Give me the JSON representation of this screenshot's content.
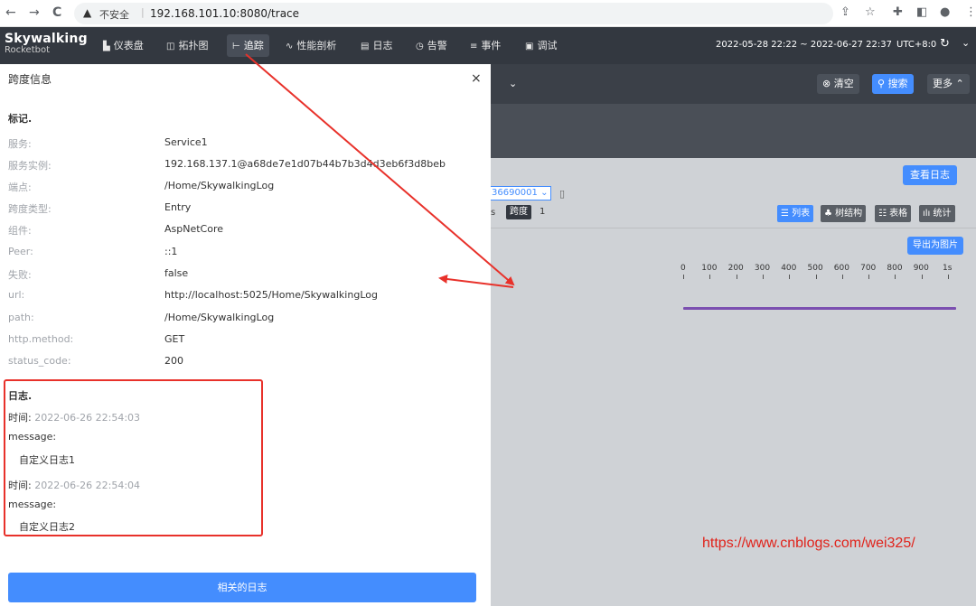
{
  "browser": {
    "back_glyph": "←",
    "forward_glyph": "→",
    "reload_glyph": "C",
    "warn_glyph": "▲",
    "insecure_label": "不安全",
    "separator": "|",
    "url": "192.168.101.10:8080/trace",
    "icons": [
      "share-icon",
      "star-icon",
      "extension-icon",
      "sidebar-icon",
      "profile-icon",
      "menu-icon"
    ]
  },
  "app": {
    "logo_title": "Skywalking",
    "logo_subtitle": "Rocketbot",
    "nav": [
      {
        "label": "仪表盘",
        "icon": "dashboard-icon",
        "glyph": "▙"
      },
      {
        "label": "拓扑图",
        "icon": "topology-icon",
        "glyph": "◫"
      },
      {
        "label": "追踪",
        "icon": "trace-icon",
        "glyph": "⊢",
        "active": true
      },
      {
        "label": "性能剖析",
        "icon": "profile-icon",
        "glyph": "∿"
      },
      {
        "label": "日志",
        "icon": "log-icon",
        "glyph": "▤"
      },
      {
        "label": "告警",
        "icon": "alarm-icon",
        "glyph": "◷"
      },
      {
        "label": "事件",
        "icon": "event-icon",
        "glyph": "≡"
      },
      {
        "label": "调试",
        "icon": "debug-icon",
        "glyph": "▣"
      }
    ],
    "date_range": "2022-05-28 22:22 ~ 2022-06-27 22:37",
    "timezone": "UTC+8:0",
    "refresh_glyph": "↻",
    "chevron_glyph": "⌃"
  },
  "toolbar": {
    "dropdown_glyph": "⌄",
    "clear_label": "清空",
    "search_label": "搜索",
    "more_label": "更多"
  },
  "trace": {
    "view_logs_label": "查看日志",
    "trace_id_partial": "36690001",
    "select_glyph": "⌄",
    "duration_suffix": "s",
    "span_label": "跨度",
    "span_count": "1",
    "views": [
      "列表",
      "树结构",
      "表格",
      "统计"
    ],
    "view_glyphs": [
      "☰",
      "♣",
      "☷",
      "ılı"
    ],
    "export_label": "导出为图片",
    "axis_ticks": [
      "0",
      "100",
      "200",
      "300",
      "400",
      "500",
      "600",
      "700",
      "800",
      "900",
      "1s"
    ]
  },
  "drawer": {
    "title": "跨度信息",
    "close_glyph": "×",
    "tags_title": "标记.",
    "fields": [
      {
        "key": "服务:",
        "value": "Service1"
      },
      {
        "key": "服务实例:",
        "value": "192.168.137.1@a68de7e1d07b44b7b3d4d3eb6f3d8beb"
      },
      {
        "key": "端点:",
        "value": "/Home/SkywalkingLog"
      },
      {
        "key": "跨度类型:",
        "value": "Entry"
      },
      {
        "key": "组件:",
        "value": "AspNetCore"
      },
      {
        "key": "Peer:",
        "value": "::1"
      },
      {
        "key": "失败:",
        "value": "false"
      },
      {
        "key": "url:",
        "value": "http://localhost:5025/Home/SkywalkingLog"
      },
      {
        "key": "path:",
        "value": "/Home/SkywalkingLog"
      },
      {
        "key": "http.method:",
        "value": "GET"
      },
      {
        "key": "status_code:",
        "value": "200"
      }
    ],
    "logs_title": "日志.",
    "logs": [
      {
        "time_label": "时间:",
        "time": "2022-06-26 22:54:03",
        "message_label": "message:",
        "message": "自定义日志1"
      },
      {
        "time_label": "时间:",
        "time": "2022-06-26 22:54:04",
        "message_label": "message:",
        "message": "自定义日志2"
      }
    ],
    "related_logs_label": "相关的日志"
  },
  "watermark": "https://www.cnblogs.com/wei325/",
  "colors": {
    "accent": "#448dfe",
    "annotation": "#e8312a",
    "span_bar": "#7b4fb0",
    "nav_bg": "#333840"
  }
}
